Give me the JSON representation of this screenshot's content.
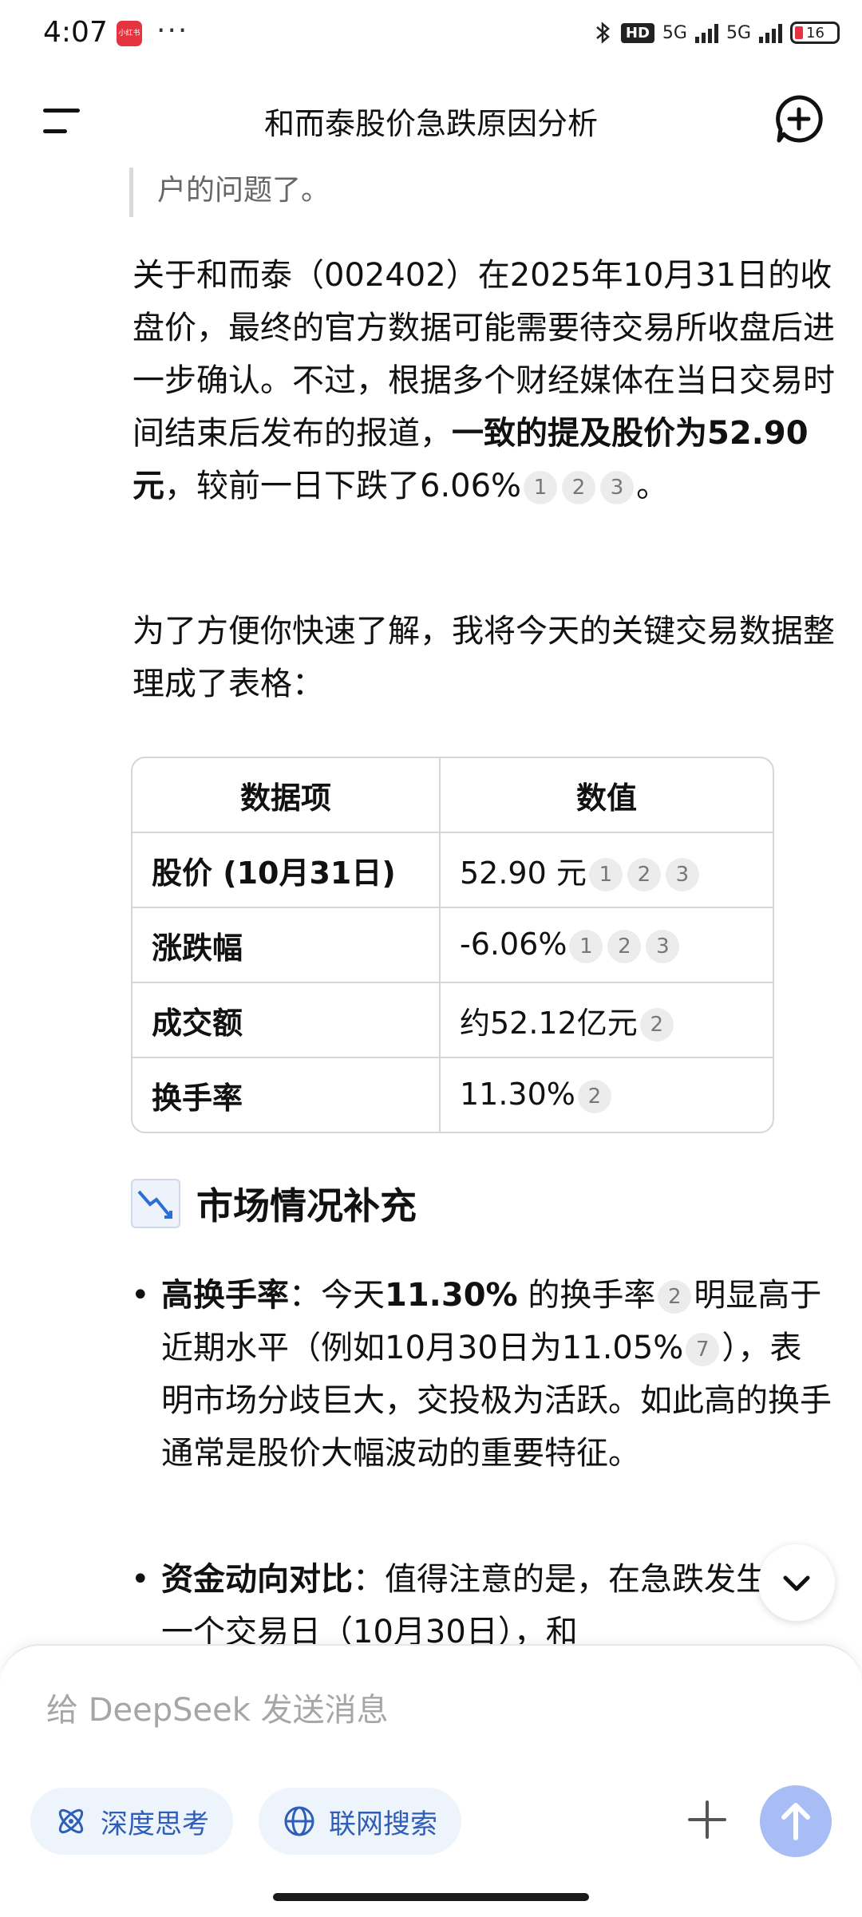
{
  "status_bar": {
    "time": "4:07",
    "app_badge": "小红书",
    "more": "···",
    "hd": "HD",
    "network1": "5G",
    "network2": "5G",
    "battery": "16"
  },
  "header": {
    "title": "和而泰股价急跌原因分析",
    "menu_icon": "menu-icon",
    "new_chat_icon": "new-chat-icon"
  },
  "content": {
    "quote_text": "户的问题了。",
    "para1": {
      "text1": "关于和而泰（002402）在2025年10月31日的收盘价，最终的官方数据可能需要待交易所收盘后进一步确认。不过，根据多个财经媒体在当日交易时间结束后发布的报道，",
      "bold": "一致的提及股价为52.90元",
      "text2": "，较前一日下跌了6.06%",
      "cites": [
        "1",
        "2",
        "3"
      ],
      "end": "。"
    },
    "para2": "为了方便你快速了解，我将今天的关键交易数据整理成了表格：",
    "table": {
      "headers": [
        "数据项",
        "数值"
      ],
      "rows": [
        {
          "label": "股价 (10月31日)",
          "value": "52.90 元",
          "cites": [
            "1",
            "2",
            "3"
          ]
        },
        {
          "label": "涨跌幅",
          "value": "-6.06%",
          "cites": [
            "1",
            "2",
            "3"
          ]
        },
        {
          "label": "成交额",
          "value": "约52.12亿元",
          "cites": [
            "2"
          ]
        },
        {
          "label": "换手率",
          "value": "11.30%",
          "cites": [
            "2"
          ]
        }
      ]
    },
    "section_title": "市场情况补充",
    "section_icon": "chart-decreasing-icon",
    "bullets": [
      {
        "title": "高换手率",
        "colon": "：今天",
        "bold2": "11.30%",
        "t1": " 的换手率",
        "cite1": "2",
        "t2": "明显高于近期水平（例如10月30日为11.05%",
        "cite2": "7",
        "t3": "），表明市场分歧巨大，交投极为活跃。如此高的换手通常是股价大幅波动的重要特征。"
      },
      {
        "title": "资金动向对比",
        "t1": "：值得注意的是，在急跌发生的前一个交易日（10月30日），和"
      }
    ]
  },
  "composer": {
    "placeholder": "给 DeepSeek 发送消息",
    "deep_think": "深度思考",
    "web_search": "联网搜索"
  },
  "colors": {
    "accent": "#2e5eb8",
    "chip_bg": "#eef4fc",
    "send_bg": "#a8bdf5",
    "battery_low": "#e5343f"
  }
}
